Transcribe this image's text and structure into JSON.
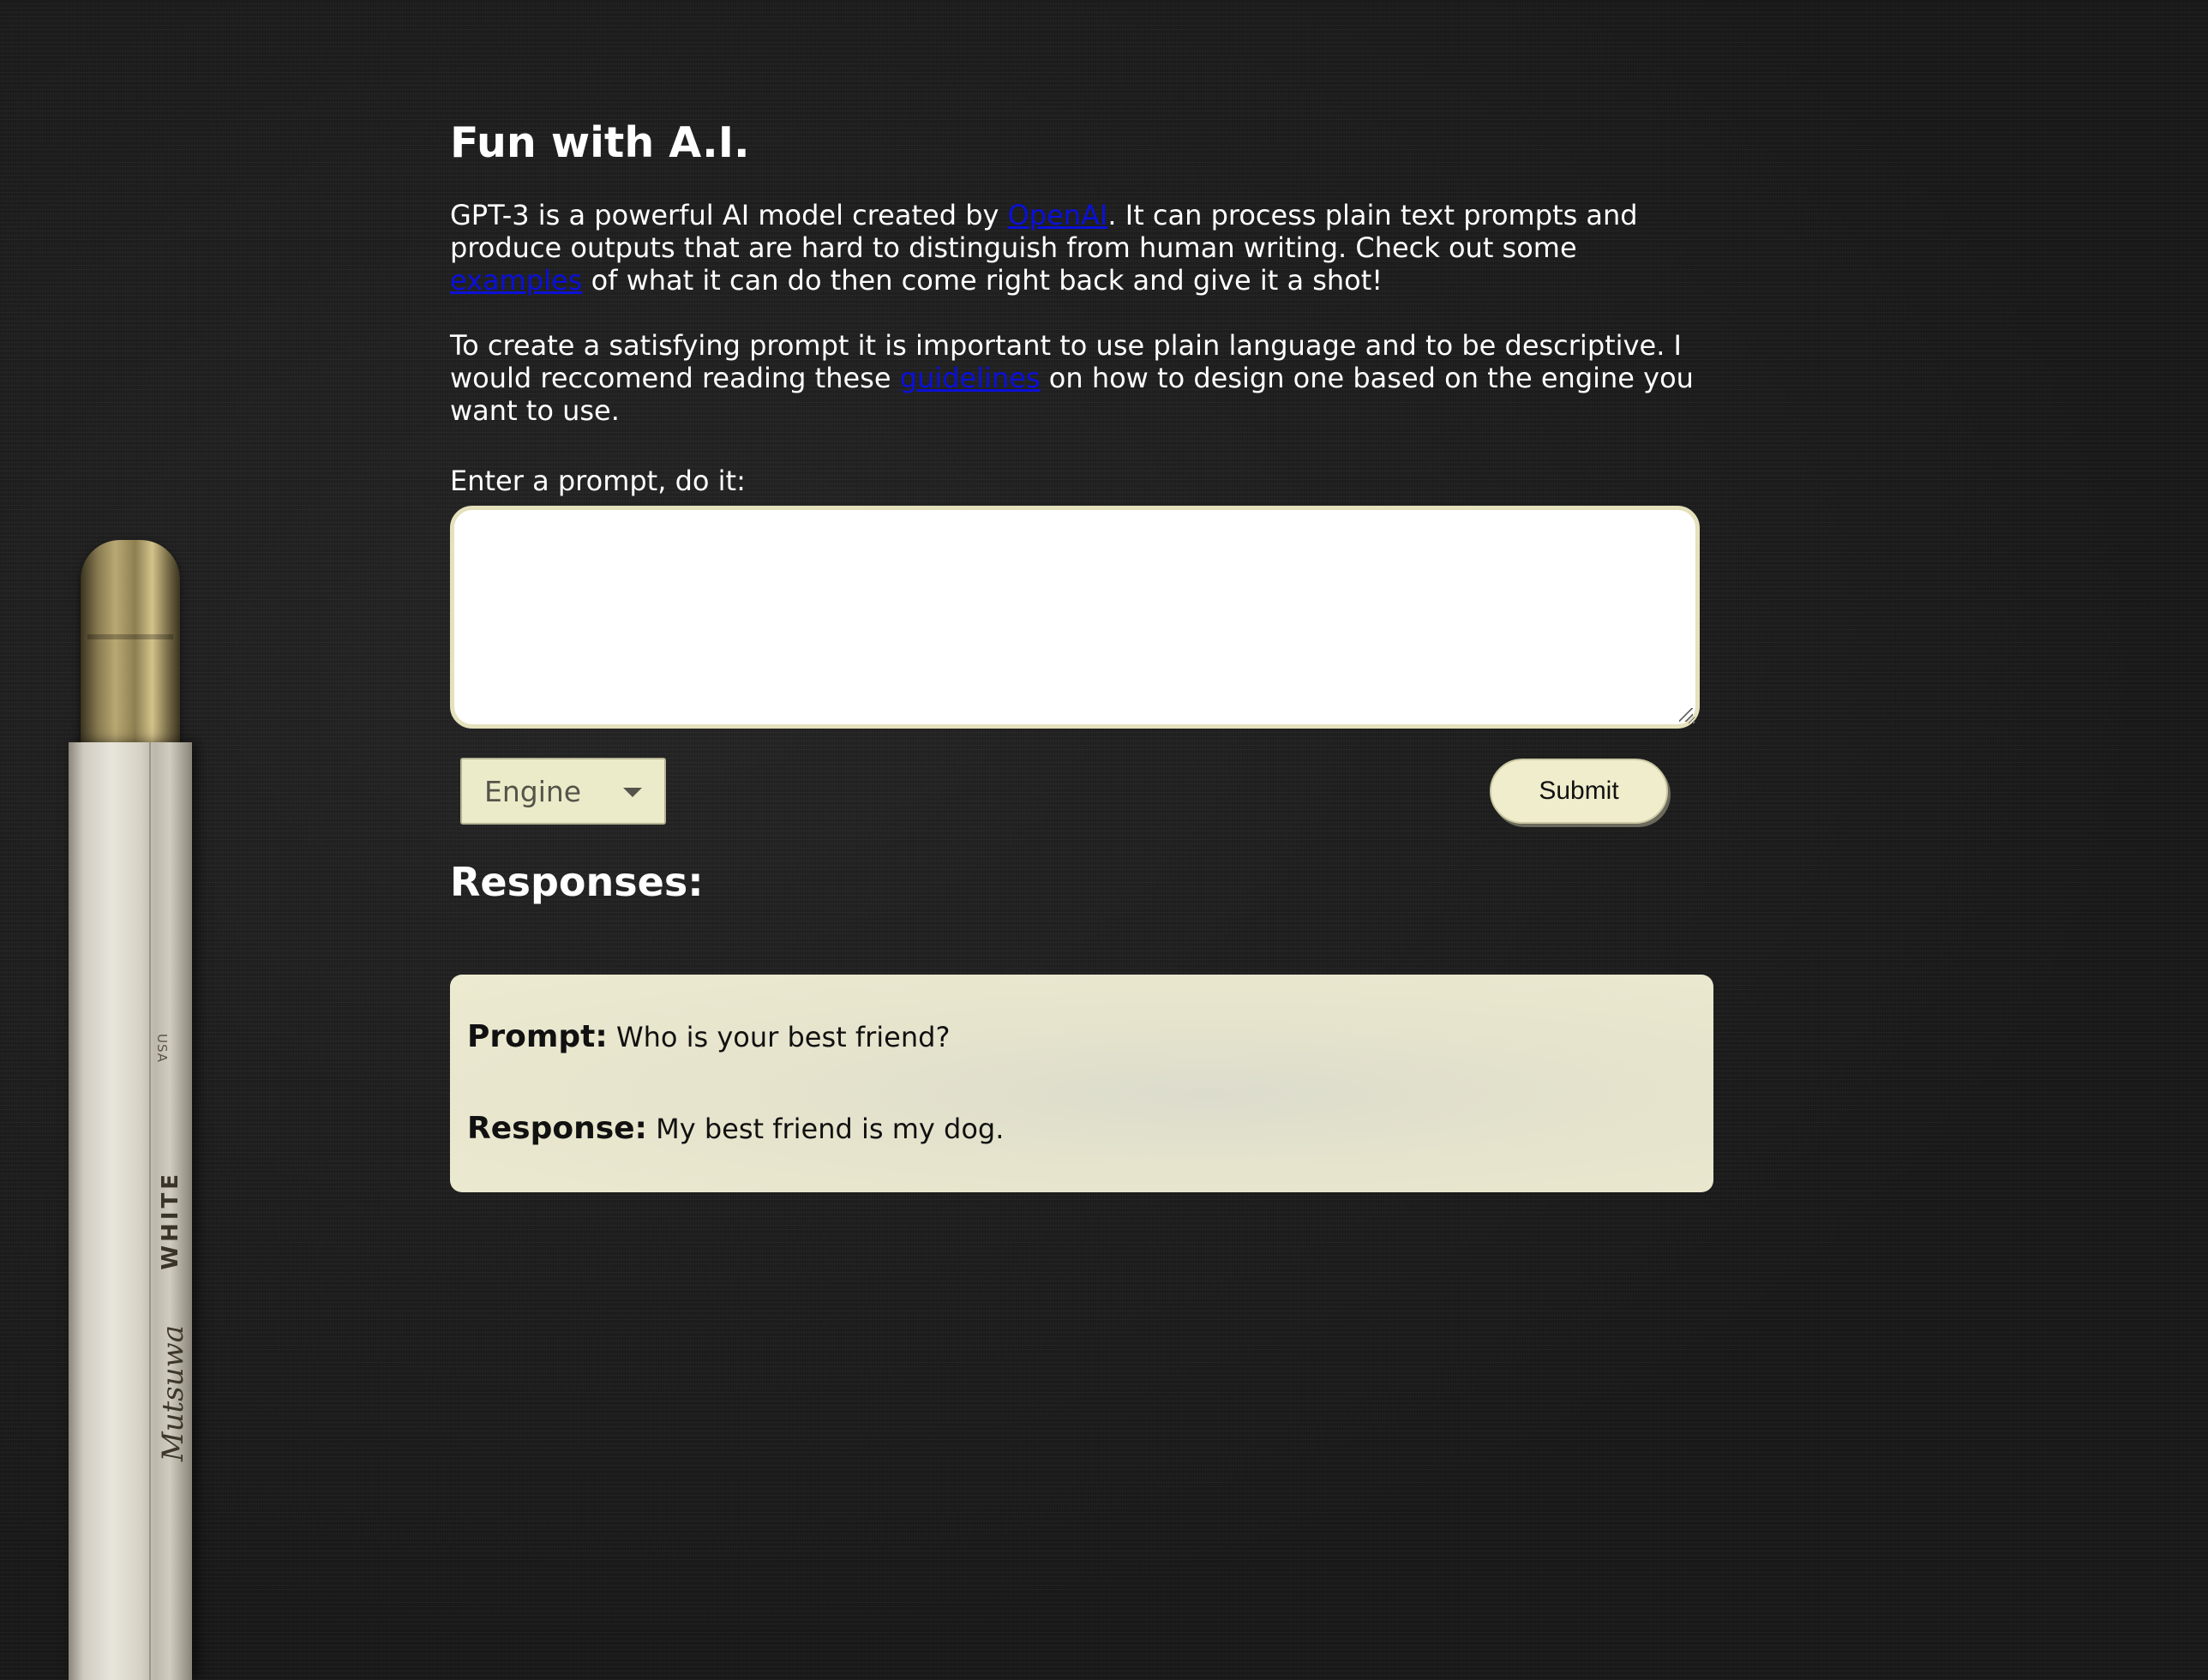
{
  "page": {
    "title": "Fun with A.I."
  },
  "intro": {
    "p1_before": "GPT-3 is a powerful AI model created by ",
    "p1_link1": "OpenAI",
    "p1_middle": ". It can process plain text prompts and produce outputs that are hard to distinguish from human writing. Check out some ",
    "p1_link2": "examples",
    "p1_after": " of what it can do then come right back and give it a shot!",
    "p2_before": "To create a satisfying prompt it is important to use plain language and to be descriptive. I would reccomend reading these ",
    "p2_link": "guidelines",
    "p2_after": " on how to design one based on the engine you want to use."
  },
  "form": {
    "prompt_label": "Enter a prompt, do it:",
    "prompt_value": "",
    "engine_selected": "Engine",
    "submit_label": "Submit"
  },
  "responses": {
    "heading": "Responses:",
    "items": [
      {
        "prompt_label": "Prompt:",
        "prompt_text": " Who is your best friend?",
        "response_label": "Response:",
        "response_text": " My best friend is my dog."
      }
    ]
  },
  "decor": {
    "pencil_text_usa": "USA",
    "pencil_text_white": "WHITE",
    "pencil_text_brand": "Mutsuwa"
  },
  "colors": {
    "background": "#1c1c1c",
    "link": "#0b10d8",
    "card": "#eceacf",
    "button": "#efedcb"
  }
}
